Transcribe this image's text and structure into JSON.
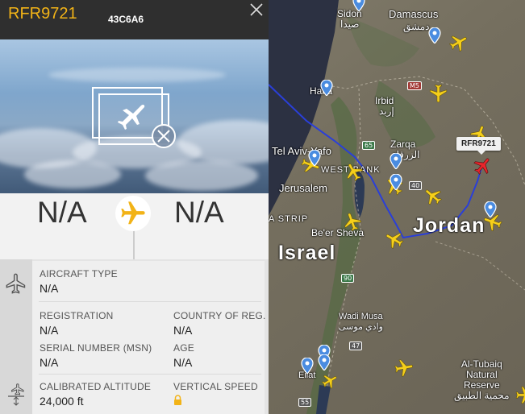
{
  "flight": {
    "callsign": "RFR9721",
    "hex": "43C6A6",
    "origin": "N/A",
    "destination": "N/A"
  },
  "details": {
    "aircraft_type_label": "AIRCRAFT TYPE",
    "aircraft_type_value": "N/A",
    "registration_label": "REGISTRATION",
    "registration_value": "N/A",
    "country_label": "COUNTRY OF REG.",
    "country_value": "N/A",
    "serial_label": "SERIAL NUMBER (MSN)",
    "serial_value": "N/A",
    "age_label": "AGE",
    "age_value": "N/A",
    "altitude_label": "CALIBRATED ALTITUDE",
    "altitude_value": "24,000 ft",
    "vspeed_label": "VERTICAL SPEED"
  },
  "map": {
    "callout": "RFR9721",
    "labels": {
      "sidon": "Sidon",
      "sidon_ar": "صيدا",
      "damascus": "Damascus",
      "damascus_ar": "دمشق",
      "haifa": "Haifa",
      "irbid": "Irbid",
      "irbid_ar": "إربد",
      "tel_aviv": "Tel Aviv-Yafo",
      "zarqa": "Zarqa",
      "zarqa_ar": "الزرقاء",
      "west_bank": "WEST BANK",
      "jerusalem": "Jerusalem",
      "gaza": "A STRIP",
      "beer_sheva": "Be'er Sheva",
      "jordan": "Jordan",
      "israel": "Israel",
      "wadi_musa": "Wadi Musa",
      "wadi_musa_ar": "وادي موسى",
      "eilat": "Eilat",
      "al_tubaiq_1": "Al-Tubaiq",
      "al_tubaiq_2": "Natural",
      "al_tubaiq_3": "Reserve",
      "al_tubaiq_ar": "محمية الطبيق"
    },
    "roads": {
      "m5": "M5",
      "r65": "65",
      "r40": "40",
      "r47": "47",
      "r55": "55",
      "r90": "90"
    },
    "colors": {
      "track": "#2a3fd8",
      "plane": "#f5cf1a",
      "selected_plane": "#e8252b",
      "pin": "#4a8ce0",
      "accent": "#f2b317"
    }
  }
}
